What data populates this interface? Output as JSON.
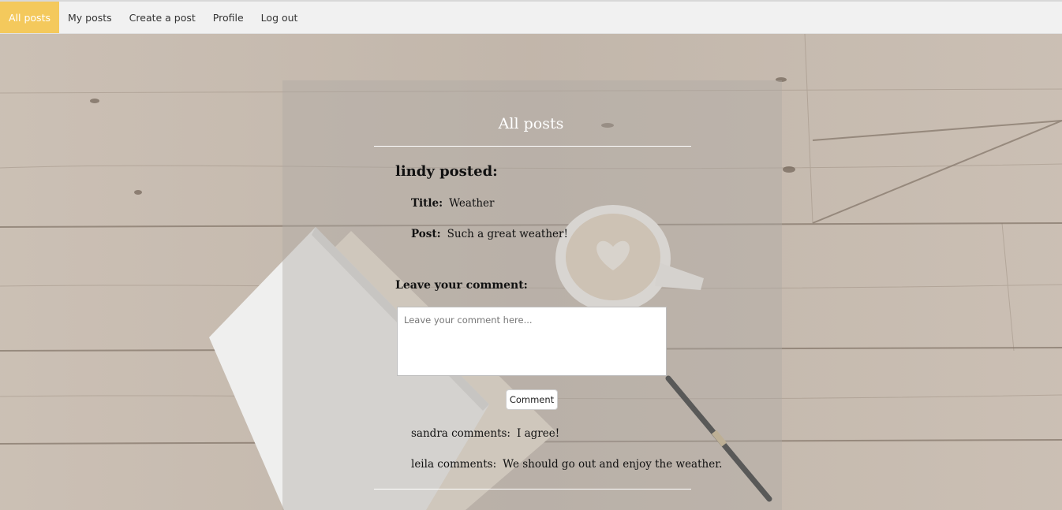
{
  "nav": {
    "items": [
      {
        "label": "All posts",
        "active": true
      },
      {
        "label": "My posts",
        "active": false
      },
      {
        "label": "Create a post",
        "active": false
      },
      {
        "label": "Profile",
        "active": false
      },
      {
        "label": "Log out",
        "active": false
      }
    ]
  },
  "page": {
    "title": "All posts"
  },
  "post": {
    "author_line": "lindy posted:",
    "title_label": "Title:",
    "title_value": "Weather",
    "post_label": "Post:",
    "post_value": "Such a great weather!"
  },
  "comment_form": {
    "heading": "Leave your comment:",
    "placeholder": "Leave your comment here...",
    "button_label": "Comment"
  },
  "comments": [
    {
      "who": "sandra comments:",
      "text": "I agree!"
    },
    {
      "who": "leila comments:",
      "text": "We should go out and enjoy the weather."
    }
  ],
  "colors": {
    "accent": "#f4c95c",
    "nav_bg": "#f1f1f1"
  },
  "icons": [
    "coffee-cup-icon",
    "notebook-icon",
    "pen-icon"
  ]
}
